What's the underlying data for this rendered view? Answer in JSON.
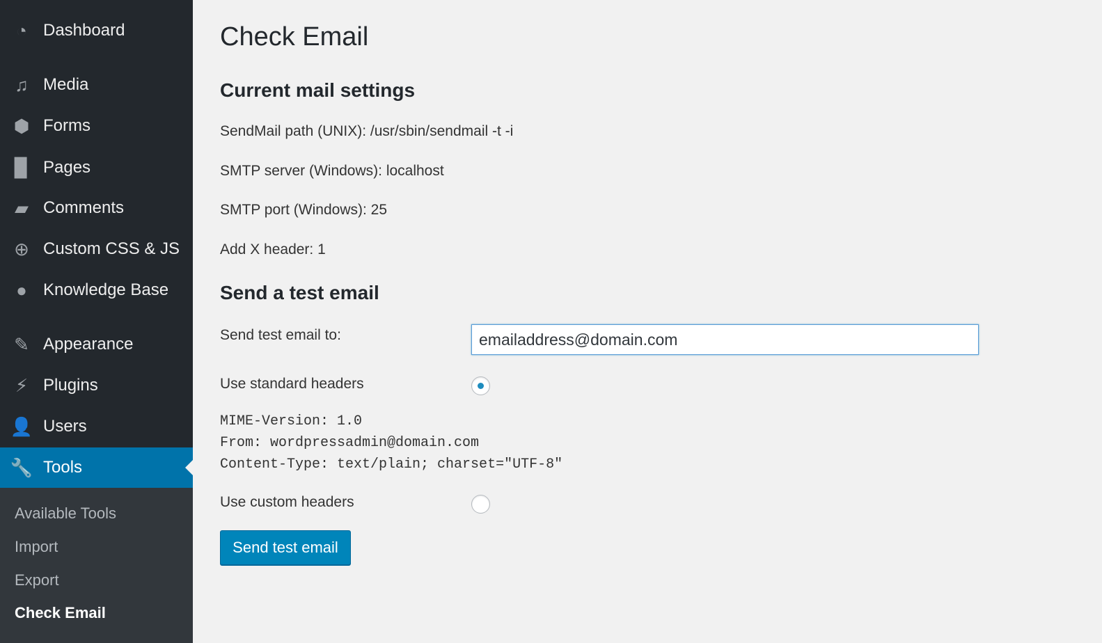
{
  "sidebar": {
    "items": [
      {
        "label": "Dashboard",
        "icon": "dashboard-icon"
      },
      {
        "label": "Media",
        "icon": "media-icon"
      },
      {
        "label": "Forms",
        "icon": "forms-icon"
      },
      {
        "label": "Pages",
        "icon": "pages-icon"
      },
      {
        "label": "Comments",
        "icon": "comments-icon"
      },
      {
        "label": "Custom CSS & JS",
        "icon": "plus-circle-icon"
      },
      {
        "label": "Knowledge Base",
        "icon": "lightbulb-icon"
      },
      {
        "label": "Appearance",
        "icon": "paintbrush-icon"
      },
      {
        "label": "Plugins",
        "icon": "plugin-icon"
      },
      {
        "label": "Users",
        "icon": "user-icon"
      },
      {
        "label": "Tools",
        "icon": "wrench-icon",
        "active": true
      }
    ],
    "submenu": [
      {
        "label": "Available Tools"
      },
      {
        "label": "Import"
      },
      {
        "label": "Export"
      },
      {
        "label": "Check Email",
        "current": true
      }
    ]
  },
  "colors": {
    "sidebar": "#23282d",
    "submenu": "#32373c",
    "accent": "#0073aa",
    "button": "#0085ba"
  },
  "main": {
    "title": "Check Email",
    "settings_heading": "Current mail settings",
    "settings": [
      "SendMail path (UNIX): /usr/sbin/sendmail -t -i",
      "SMTP server (Windows): localhost",
      "SMTP port (Windows): 25",
      "Add X header: 1"
    ],
    "test_heading": "Send a test email",
    "send_to_label": "Send test email to:",
    "send_to_value": "emailaddress@domain.com",
    "standard_headers_label": "Use standard headers",
    "standard_headers_selected": true,
    "headers": [
      "MIME-Version: 1.0",
      "From: wordpressadmin@domain.com",
      "Content-Type: text/plain; charset=\"UTF-8\""
    ],
    "custom_headers_label": "Use custom headers",
    "custom_headers_selected": false,
    "send_button": "Send test email"
  }
}
